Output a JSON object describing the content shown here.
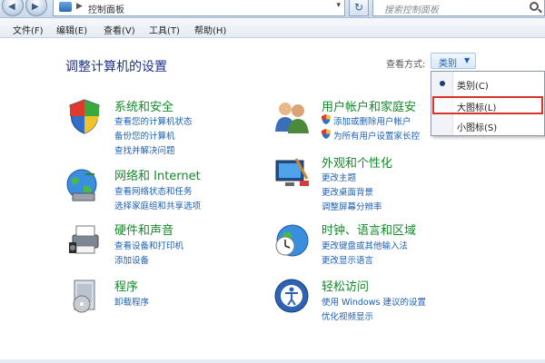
{
  "address": {
    "path": "控制面板",
    "search_placeholder": "搜索控制面板"
  },
  "menu": [
    "文件(F)",
    "编辑(E)",
    "查看(V)",
    "工具(T)",
    "帮助(H)"
  ],
  "page_title": "调整计算机的设置",
  "view_by": {
    "label": "查看方式:",
    "selected": "类别",
    "options": [
      "类别(C)",
      "大图标(L)",
      "小图标(S)"
    ]
  },
  "categories": [
    {
      "title": "系统和安全",
      "links": [
        "查看您的计算机状态",
        "备份您的计算机",
        "查找并解决问题"
      ]
    },
    {
      "title": "网络和 Internet",
      "links": [
        "查看网络状态和任务",
        "选择家庭组和共享选项"
      ]
    },
    {
      "title": "硬件和声音",
      "links": [
        "查看设备和打印机",
        "添加设备"
      ]
    },
    {
      "title": "程序",
      "links": [
        "卸载程序"
      ]
    },
    {
      "title": "用户帐户和家庭安",
      "links": [
        "添加或删除用户帐户",
        "为所有用户设置家长控"
      ]
    },
    {
      "title": "外观和个性化",
      "links": [
        "更改主题",
        "更改桌面背景",
        "调整屏幕分辨率"
      ]
    },
    {
      "title": "时钟、语言和区域",
      "links": [
        "更改键盘或其他输入法",
        "更改显示语言"
      ]
    },
    {
      "title": "轻松访问",
      "links": [
        "使用 Windows 建议的设置",
        "优化视频显示"
      ]
    }
  ]
}
